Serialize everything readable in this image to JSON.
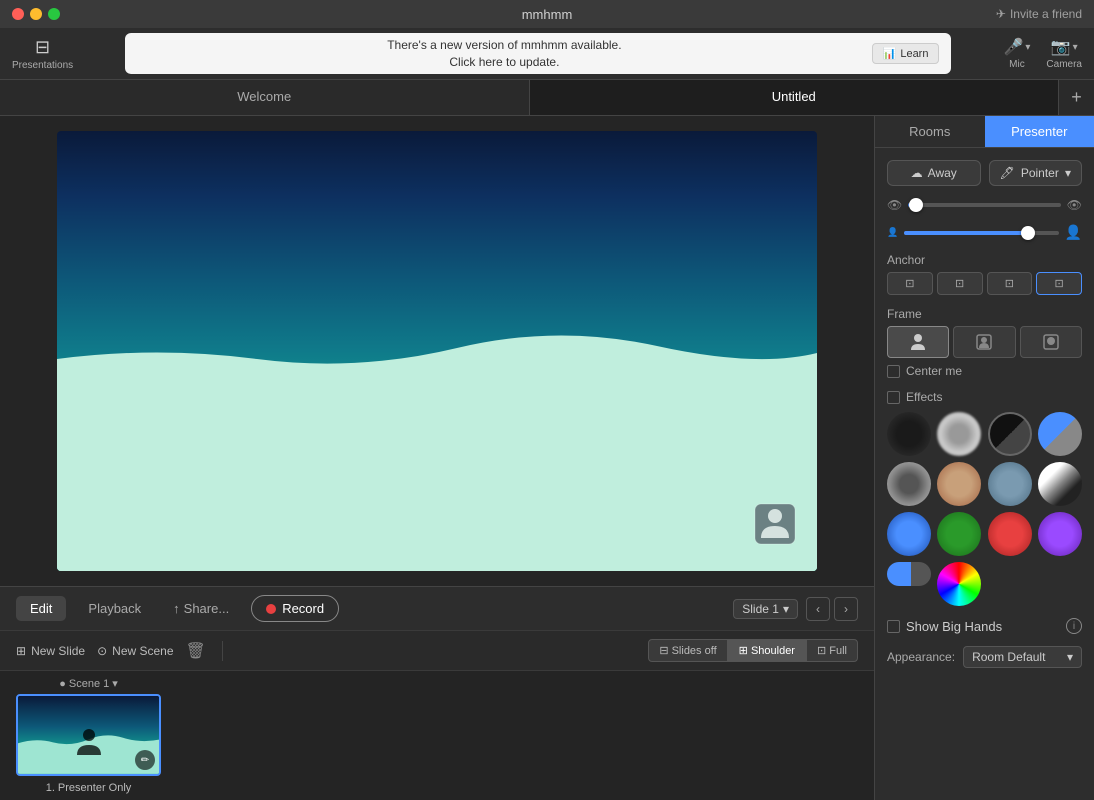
{
  "app": {
    "title": "mmhmm"
  },
  "titlebar": {
    "invite_label": "Invite a friend"
  },
  "toolbar": {
    "presentations_label": "Presentations",
    "update_message_line1": "There's a new version of mmhmm available.",
    "update_message_line2": "Click here to update.",
    "learn_label": "Learn",
    "mic_label": "Mic",
    "camera_label": "Camera"
  },
  "tabs": [
    {
      "id": "welcome",
      "label": "Welcome",
      "active": false
    },
    {
      "id": "untitled",
      "label": "Untitled",
      "active": true
    }
  ],
  "tab_add_label": "+",
  "right_panel": {
    "rooms_label": "Rooms",
    "presenter_label": "Presenter",
    "active_tab": "Presenter",
    "away_label": "Away",
    "pointer_label": "Pointer",
    "anchor_label": "Anchor",
    "frame_label": "Frame",
    "center_me_label": "Center me",
    "effects_label": "Effects",
    "show_big_hands_label": "Show Big Hands",
    "appearance_label": "Appearance:",
    "room_default_label": "Room Default",
    "slider_visibility_low_icon": "👁",
    "slider_visibility_high_icon": "👁",
    "slider_size_low_icon": "👤",
    "slider_size_high_icon": "👤",
    "visibility_slider_pct": 5,
    "size_slider_pct": 80
  },
  "bottom_toolbar": {
    "edit_label": "Edit",
    "playback_label": "Playback",
    "share_label": "Share...",
    "record_label": "Record",
    "slide_label": "Slide 1",
    "prev_label": "‹",
    "next_label": "›"
  },
  "scene_toolbar": {
    "new_slide_label": "New Slide",
    "new_scene_label": "New Scene",
    "delete_label": "🗑",
    "slides_off_label": "Slides off",
    "shoulder_label": "Shoulder",
    "full_label": "Full"
  },
  "scenes": [
    {
      "id": "scene1",
      "label": "Scene 1",
      "dropdown": "▾",
      "name": "1. Presenter Only",
      "active": true
    }
  ]
}
